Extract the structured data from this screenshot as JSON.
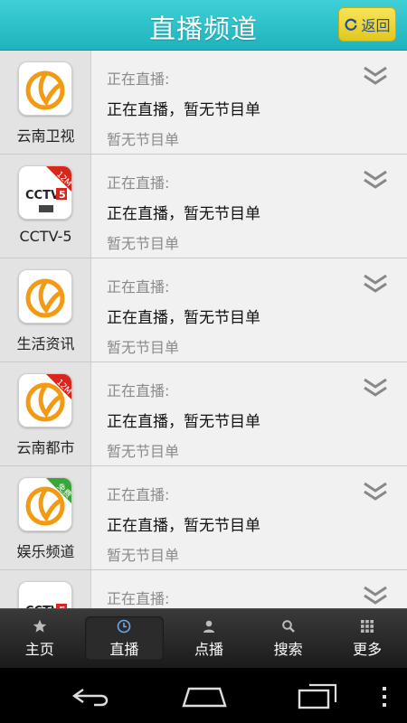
{
  "header": {
    "title": "直播频道",
    "back_label": "返回"
  },
  "channels": [
    {
      "name": "云南卫视",
      "line1": "正在直播:",
      "line2": "正在直播，暂无节目单",
      "line3": "暂无节目单",
      "logo": "yunnan",
      "badge": ""
    },
    {
      "name": "CCTV-5",
      "line1": "正在直播:",
      "line2": "正在直播，暂无节目单",
      "line3": "暂无节目单",
      "logo": "cctv5",
      "badge": "12M"
    },
    {
      "name": "生活资讯",
      "line1": "正在直播:",
      "line2": "正在直播，暂无节目单",
      "line3": "暂无节目单",
      "logo": "yunnan",
      "badge": ""
    },
    {
      "name": "云南都市",
      "line1": "正在直播:",
      "line2": "正在直播，暂无节目单",
      "line3": "暂无节目单",
      "logo": "yunnan",
      "badge": "12M"
    },
    {
      "name": "娱乐频道",
      "line1": "正在直播:",
      "line2": "正在直播，暂无节目单",
      "line3": "暂无节目单",
      "logo": "yunnan",
      "badge": "免费"
    },
    {
      "name": "",
      "line1": "正在直播:",
      "line2": "",
      "line3": "",
      "logo": "cctv",
      "badge": ""
    }
  ],
  "bottom_nav": [
    {
      "label": "主页",
      "icon": "star-icon"
    },
    {
      "label": "直播",
      "icon": "clock-icon",
      "active": true
    },
    {
      "label": "点播",
      "icon": "person-icon"
    },
    {
      "label": "搜索",
      "icon": "search-icon"
    },
    {
      "label": "更多",
      "icon": "grid-icon"
    }
  ],
  "colors": {
    "header": "#2cc1c9",
    "back_button": "#f2dc3c",
    "badge_red": "#d9261c",
    "badge_green": "#3aa63a",
    "logo_orange": "#f39a14"
  }
}
